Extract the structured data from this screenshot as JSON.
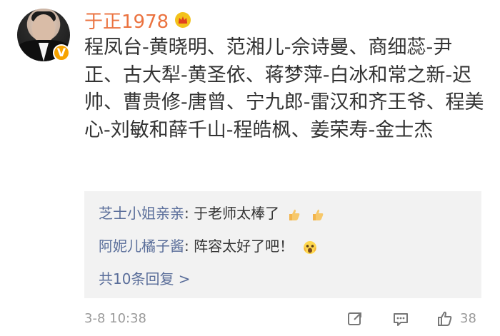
{
  "post": {
    "author": "于正1978",
    "text": "程凤台-黄晓明、范湘儿-佘诗曼、商细蕊-尹正、古大犁-黄圣依、蒋梦萍-白冰和常之新-迟帅、曹贵修-唐曾、宁九郎-雷汉和齐王爷、程美心-刘敏和薛千山-程皓枫、姜荣寿-金士杰",
    "timestamp": "3-8 10:38",
    "likes": "38"
  },
  "replies": [
    {
      "name": "芝士小姐亲亲",
      "text": "于老师太棒了"
    },
    {
      "name": "阿妮儿橘子酱",
      "text": "阵容太好了吧！"
    }
  ],
  "replies_link": "共10条回复 >",
  "colors": {
    "author": "#eb7340",
    "reply_name": "#5a6e9a",
    "panel_bg": "#f2f2f2",
    "verified_badge": "#f7a300",
    "meta_text": "#9a9a9a"
  },
  "icons": {
    "avatar": "profile-photo",
    "badge": "verified-v-icon",
    "crown": "crown-icon",
    "thumb": "thumbs-up-emoji",
    "face": "surprised-face-emoji",
    "share": "share-icon",
    "comment": "comment-icon",
    "like": "like-icon"
  }
}
